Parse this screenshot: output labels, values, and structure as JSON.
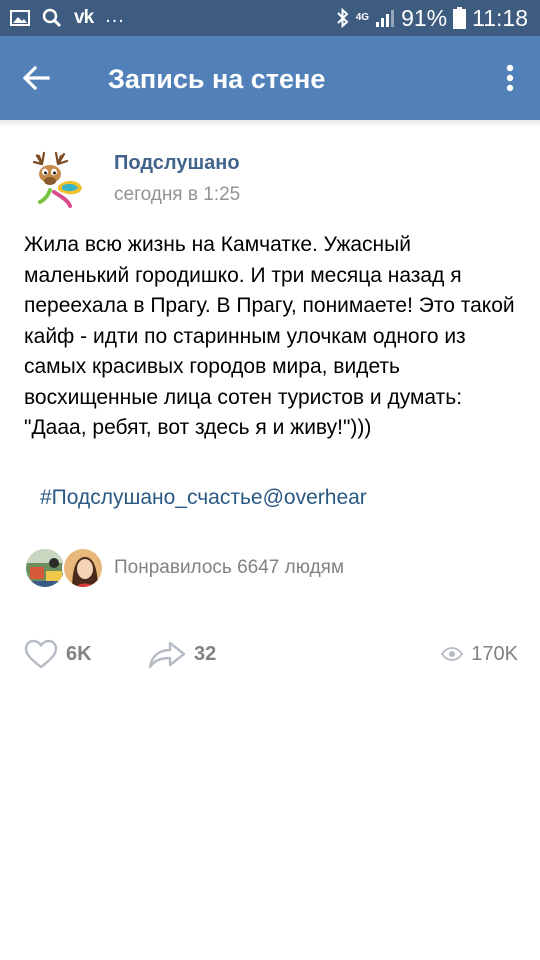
{
  "status_bar": {
    "network": "4G",
    "battery": "91%",
    "time": "11:18",
    "left_icons": [
      "gallery-icon",
      "search-icon",
      "vk-icon",
      "more-notifications-icon"
    ],
    "right_icons": [
      "bluetooth-icon",
      "signal-icon",
      "battery-icon"
    ]
  },
  "toolbar": {
    "title": "Запись на стене",
    "back_icon": "arrow-back-icon",
    "menu_icon": "more-vertical-icon"
  },
  "post": {
    "author": "Подслушано",
    "time": "сегодня в 1:25",
    "text": "Жила всю жизнь на Камчатке. Ужасный маленький городишко. И три месяца назад я переехала в Прагу. В Прагу, понимаете! Это такой кайф - идти по старинным улочкам одного из самых красивых городов мира, видеть восхищенные лица сотен туристов и думать: \"Дааа, ребят, вот здесь я и живу!\")))",
    "hashtag": "#Подслушано_счастье@overhear"
  },
  "likes": {
    "text": "Понравилось 6647 людям"
  },
  "actions": {
    "likes_count": "6K",
    "shares_count": "32",
    "views_count": "170K"
  },
  "colors": {
    "status_bar": "#3d5c7f",
    "toolbar": "#5181b8",
    "author": "#42648b",
    "link": "#2a5885",
    "secondary_text": "#939393",
    "action_icon": "#b6bcc5"
  }
}
